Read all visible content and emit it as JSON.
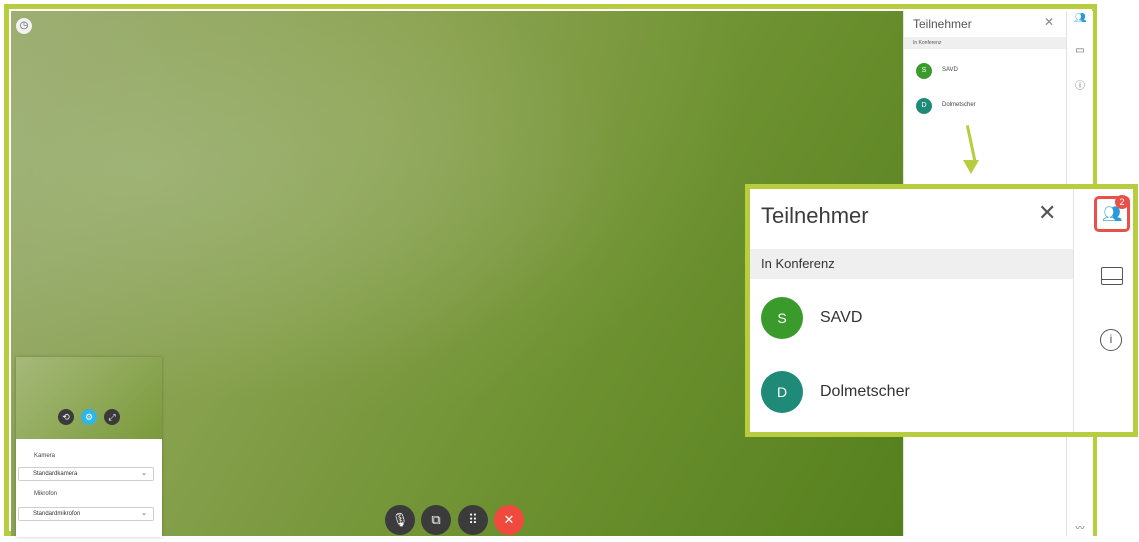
{
  "colors": {
    "accent_frame": "#b7cd3f",
    "avatar_s": "#3a9a2c",
    "avatar_d": "#1f8a78",
    "end_call": "#f04a3e",
    "badge": "#e8504a",
    "people_icon": "#2b9ad8"
  },
  "preview": {
    "camera_label": "Kamera",
    "camera_value": "Standardkamera",
    "mic_label": "Mikrofon",
    "mic_value": "Standardmikrofon"
  },
  "controls": [
    "mute-microphone",
    "share-screen",
    "keypad",
    "end-call"
  ],
  "participants_panel": {
    "title": "Teilnehmer",
    "section": "In Konferenz",
    "participants": [
      {
        "initial": "S",
        "name": "SAVD"
      },
      {
        "initial": "D",
        "name": "Dolmetscher"
      }
    ],
    "badge_count": "2"
  }
}
